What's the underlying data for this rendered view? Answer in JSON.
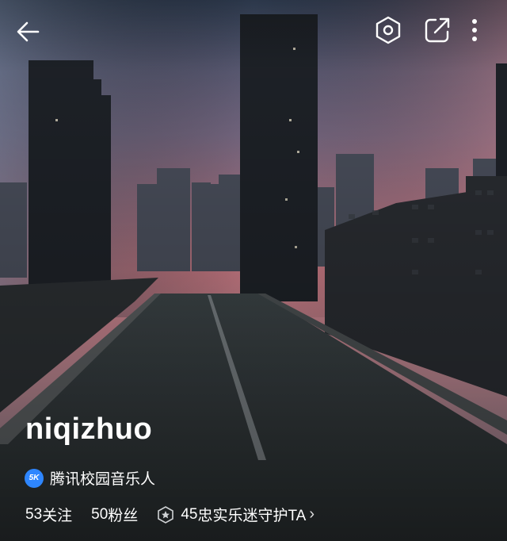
{
  "header": {
    "back_icon": "arrow-left-icon",
    "settings_icon": "hexagon-settings-icon",
    "share_icon": "share-icon",
    "more_icon": "more-vertical-icon"
  },
  "profile": {
    "username": "niqizhuo",
    "badge": {
      "logo_text": "5K",
      "label": "腾讯校园音乐人"
    },
    "stats": {
      "following_count": "53",
      "following_label": "关注",
      "fans_count": "50",
      "fans_label": "粉丝",
      "loyal_count": "45",
      "loyal_label": "忠实乐迷守护TA"
    }
  }
}
